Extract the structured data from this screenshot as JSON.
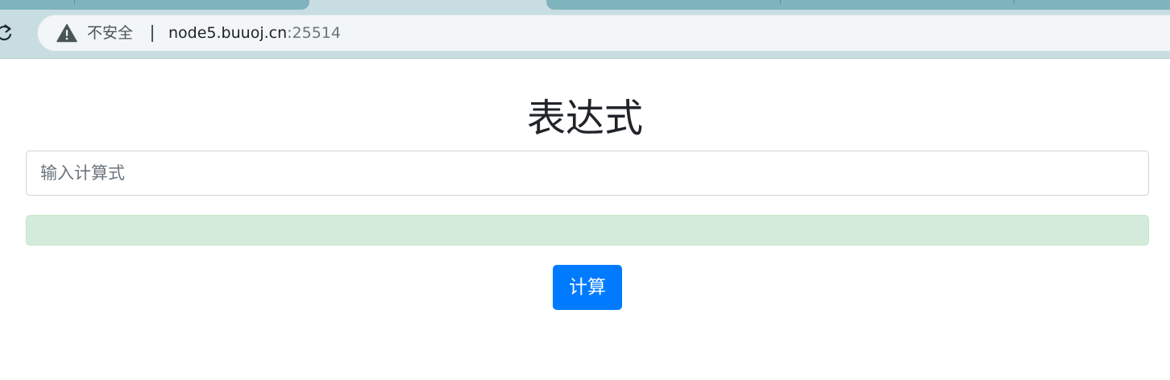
{
  "browser": {
    "security_label": "不安全",
    "url_host": "node5.buuoj.cn",
    "url_port": ":25514",
    "colors": {
      "tabstrip": "#c8dde2",
      "inactive_tab": "#7fb3bd",
      "omnibox": "#f2f6f7"
    },
    "icons": {
      "reload": "reload-icon",
      "security": "warning-triangle-icon"
    }
  },
  "page": {
    "title": "表达式",
    "input": {
      "placeholder": "输入计算式",
      "value": ""
    },
    "result": {
      "text": ""
    },
    "button_label": "计算",
    "colors": {
      "primary": "#007bff",
      "result_bg": "#d4ebdb",
      "text": "#212529"
    }
  }
}
